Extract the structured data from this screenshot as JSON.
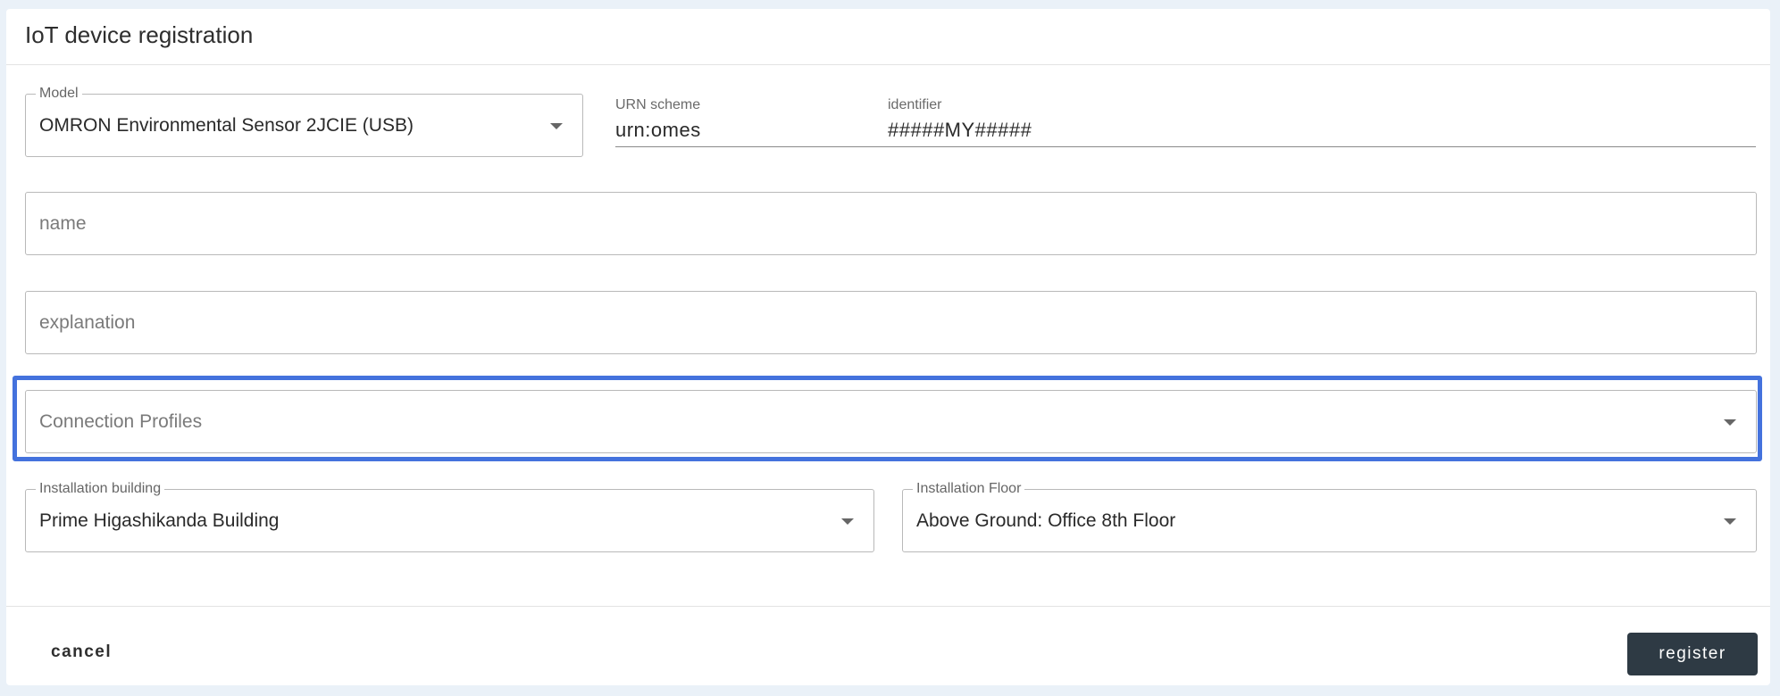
{
  "dialog": {
    "title": "IoT device registration"
  },
  "model": {
    "label": "Model",
    "value": "OMRON Environmental Sensor 2JCIE (USB)"
  },
  "urn_scheme": {
    "label": "URN scheme",
    "value": "urn:omes"
  },
  "identifier": {
    "label": "identifier",
    "value": "#####MY#####"
  },
  "name_field": {
    "placeholder": "name"
  },
  "explanation_field": {
    "placeholder": "explanation"
  },
  "connection_profiles": {
    "placeholder": "Connection Profiles"
  },
  "installation_building": {
    "label": "Installation building",
    "value": "Prime Higashikanda Building"
  },
  "installation_floor": {
    "label": "Installation Floor",
    "value": "Above Ground: Office 8th Floor"
  },
  "actions": {
    "cancel_label": "cancel",
    "register_label": "register"
  },
  "colors": {
    "highlight": "#4472dd",
    "register_bg": "#2e3a44",
    "page_bg": "#eaf1f8"
  }
}
